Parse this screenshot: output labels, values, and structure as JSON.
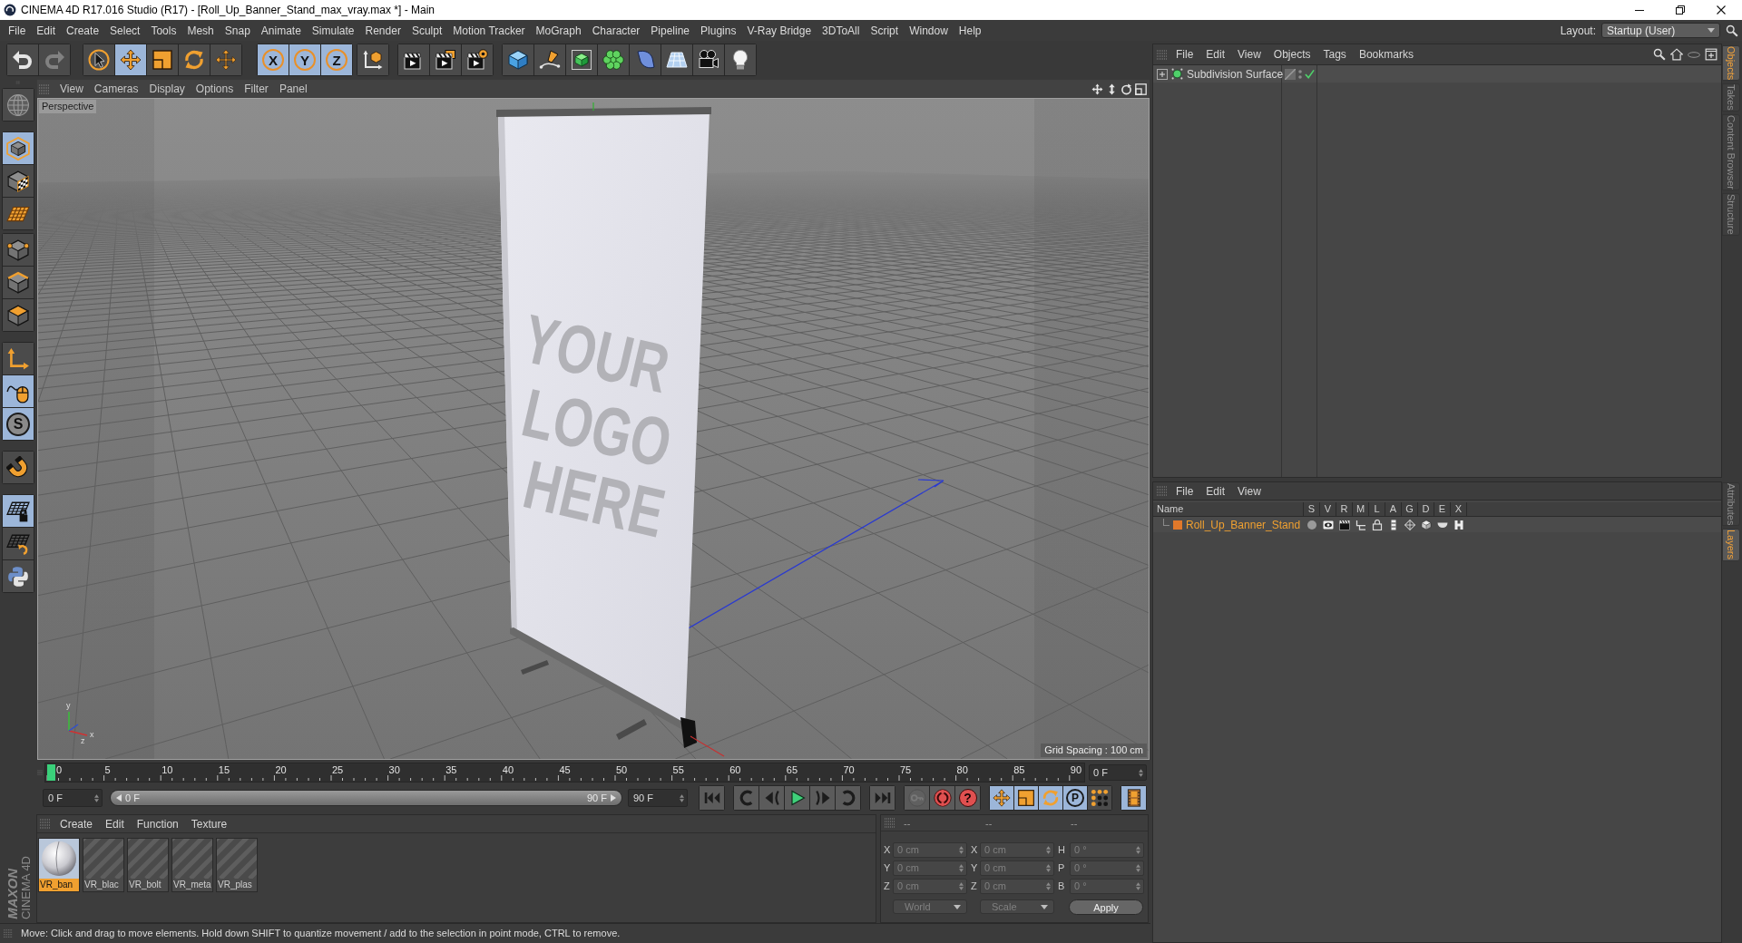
{
  "window": {
    "title": "CINEMA 4D R17.016 Studio (R17) - [Roll_Up_Banner_Stand_max_vray.max *] - Main"
  },
  "menu_bar": [
    "File",
    "Edit",
    "Create",
    "Select",
    "Tools",
    "Mesh",
    "Snap",
    "Animate",
    "Simulate",
    "Render",
    "Sculpt",
    "Motion Tracker",
    "MoGraph",
    "Character",
    "Pipeline",
    "Plugins",
    "V-Ray Bridge",
    "3DToAll",
    "Script",
    "Window",
    "Help"
  ],
  "layout": {
    "label": "Layout:",
    "value": "Startup (User)"
  },
  "toolbar": {
    "history": [
      {
        "kind": "undo",
        "disabled": false
      },
      {
        "kind": "redo",
        "disabled": true
      }
    ],
    "groups": [
      [
        {
          "kind": "select",
          "selected": false
        },
        {
          "kind": "move",
          "selected": true
        },
        {
          "kind": "scale",
          "selected": false
        },
        {
          "kind": "rotate",
          "selected": false
        },
        {
          "kind": "transform",
          "selected": false
        }
      ],
      [
        {
          "kind": "axis",
          "label": "X",
          "selected": true
        },
        {
          "kind": "axis",
          "label": "Y",
          "selected": true
        },
        {
          "kind": "axis",
          "label": "Z",
          "selected": true
        }
      ],
      [
        {
          "kind": "coords",
          "selected": false
        }
      ],
      [
        {
          "kind": "render_view",
          "selected": false
        },
        {
          "kind": "render_region",
          "selected": false
        },
        {
          "kind": "render_settings",
          "selected": false
        }
      ],
      [
        {
          "kind": "cube",
          "selected": false
        },
        {
          "kind": "pen",
          "selected": false
        },
        {
          "kind": "subdivision",
          "selected": false
        },
        {
          "kind": "cloner",
          "selected": false
        },
        {
          "kind": "deformer",
          "selected": false
        },
        {
          "kind": "floor",
          "selected": false
        },
        {
          "kind": "camera",
          "selected": false
        },
        {
          "kind": "light",
          "selected": false
        }
      ]
    ]
  },
  "left_toolbar": [
    [
      {
        "kind": "globe",
        "selected": false
      }
    ],
    [
      {
        "kind": "model",
        "selected": true
      },
      {
        "kind": "texture",
        "selected": false
      },
      {
        "kind": "workplane",
        "selected": false
      }
    ],
    [
      {
        "kind": "points",
        "selected": false
      },
      {
        "kind": "edges",
        "selected": false
      },
      {
        "kind": "polygons",
        "selected": false
      }
    ],
    [
      {
        "kind": "axis_mode",
        "selected": false
      },
      {
        "kind": "tweak",
        "selected": true
      },
      {
        "kind": "snap",
        "label": "S",
        "selected": true
      }
    ],
    [
      {
        "kind": "magnet",
        "selected": false
      }
    ],
    [
      {
        "kind": "grid_lock",
        "selected": true
      },
      {
        "kind": "grid_rotate",
        "selected": false
      },
      {
        "kind": "python",
        "selected": false
      }
    ]
  ],
  "maxon_logo": {
    "company": "MAXON",
    "product": "CINEMA 4D"
  },
  "viewport": {
    "menu": [
      "View",
      "Cameras",
      "Display",
      "Options",
      "Filter",
      "Panel"
    ],
    "camera": "Perspective",
    "banner_text": [
      "YOUR",
      "LOGO",
      "HERE"
    ],
    "axis_labels": [
      "y",
      "x",
      "z"
    ],
    "grid_spacing": "Grid Spacing : 100 cm"
  },
  "timeline": {
    "ticks": [
      "0",
      "5",
      "10",
      "15",
      "20",
      "25",
      "30",
      "35",
      "40",
      "45",
      "50",
      "55",
      "60",
      "65",
      "70",
      "75",
      "80",
      "85",
      "90"
    ],
    "playhead": {
      "level": 0
    },
    "current_frame": "0 F",
    "start_frame": "0 F",
    "range": {
      "level": 1
    },
    "range_start": "0 F",
    "range_end": "90 F",
    "end_frame": "90 F"
  },
  "playback": [
    [
      {
        "kind": "first"
      }
    ],
    [
      {
        "kind": "prev_key"
      },
      {
        "kind": "step_back"
      },
      {
        "kind": "play"
      },
      {
        "kind": "step_forward"
      },
      {
        "kind": "next_key"
      }
    ],
    [
      {
        "kind": "last"
      }
    ]
  ],
  "keying": [
    {
      "kind": "key",
      "disabled": true
    },
    {
      "kind": "autokey",
      "disabled": false
    },
    {
      "kind": "help",
      "label": "?",
      "disabled": false
    }
  ],
  "key_modes": [
    {
      "kind": "move",
      "selected": true
    },
    {
      "kind": "scale",
      "selected": true
    },
    {
      "kind": "rotate",
      "selected": true
    },
    {
      "kind": "param",
      "label": "P",
      "selected": true
    },
    {
      "kind": "point_level",
      "selected": false
    }
  ],
  "timeline_button": {
    "selected": true
  },
  "material_manager": {
    "menu": [
      "Create",
      "Edit",
      "Function",
      "Texture"
    ],
    "materials": [
      {
        "label": "VR_ban",
        "kind": "preview",
        "selected": true
      },
      {
        "label": "VR_blac",
        "kind": "pending",
        "selected": false
      },
      {
        "label": "VR_bolt",
        "kind": "pending",
        "selected": false
      },
      {
        "label": "VR_meta",
        "kind": "pending",
        "selected": false
      },
      {
        "label": "VR_plas",
        "kind": "pending",
        "selected": false
      }
    ]
  },
  "coordinates": {
    "headers": [
      "--",
      "--",
      "--"
    ],
    "disabled": true,
    "rows": [
      [
        {
          "axis": "X",
          "value": "0 cm"
        },
        {
          "axis": "X",
          "value": "0 cm"
        },
        {
          "axis": "H",
          "value": "0 °"
        }
      ],
      [
        {
          "axis": "Y",
          "value": "0 cm"
        },
        {
          "axis": "Y",
          "value": "0 cm"
        },
        {
          "axis": "P",
          "value": "0 °"
        }
      ],
      [
        {
          "axis": "Z",
          "value": "0 cm"
        },
        {
          "axis": "Z",
          "value": "0 cm"
        },
        {
          "axis": "B",
          "value": "0 °"
        }
      ]
    ],
    "dropdowns": [
      "World",
      "Scale"
    ],
    "apply": "Apply"
  },
  "status_bar": "Move: Click and drag to move elements. Hold down SHIFT to quantize movement / add to the selection in point mode, CTRL to remove.",
  "object_manager": {
    "menu": [
      "File",
      "Edit",
      "View",
      "Objects",
      "Tags",
      "Bookmarks"
    ],
    "objects": [
      {
        "name": "Subdivision Surface",
        "expanded": false,
        "selected": false,
        "enabled": true
      }
    ]
  },
  "layer_manager": {
    "menu": [
      "File",
      "Edit",
      "View"
    ],
    "columns": [
      "Name",
      "S",
      "V",
      "R",
      "M",
      "L",
      "A",
      "G",
      "D",
      "E",
      "X"
    ],
    "layers": [
      {
        "name": "Roll_Up_Banner_Stand",
        "color": "#e0782a",
        "selected": true
      }
    ]
  },
  "side_tabs": {
    "top": [
      {
        "label": "Objects",
        "selected": true
      },
      {
        "label": "Takes",
        "selected": false
      },
      {
        "label": "Content Browser",
        "selected": false
      },
      {
        "label": "Structure",
        "selected": false
      }
    ],
    "bottom": [
      {
        "label": "Attributes",
        "selected": false
      },
      {
        "label": "Layers",
        "selected": true
      }
    ]
  }
}
